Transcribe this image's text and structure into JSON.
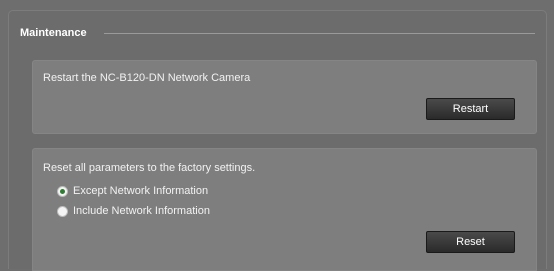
{
  "section": {
    "title": "Maintenance"
  },
  "restart": {
    "description": "Restart the NC-B120-DN Network Camera",
    "button_label": "Restart"
  },
  "reset": {
    "description": "Reset all parameters to the factory settings.",
    "options": [
      {
        "label": "Except Network Information",
        "selected": true
      },
      {
        "label": "Include Network Information",
        "selected": false
      }
    ],
    "button_label": "Reset"
  },
  "colors": {
    "background": "#6e6e6e",
    "panel": "#7e7e7e",
    "button": "#333333",
    "radio_selected": "#2f7d34"
  }
}
